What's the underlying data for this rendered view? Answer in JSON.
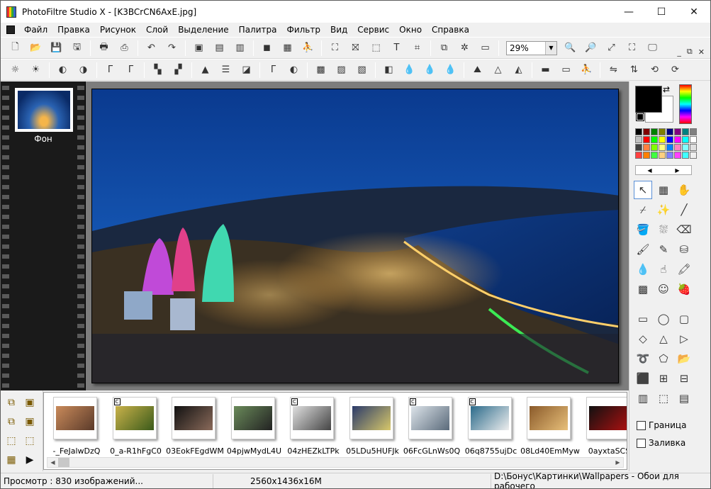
{
  "window": {
    "title": "PhotoFiltre Studio X - [K3BCrCN6AxE.jpg]",
    "controls": {
      "minimize": "—",
      "maximize": "☐",
      "close": "✕"
    }
  },
  "menu": {
    "items": [
      "Файл",
      "Правка",
      "Рисунок",
      "Слой",
      "Выделение",
      "Палитра",
      "Фильтр",
      "Вид",
      "Сервис",
      "Окно",
      "Справка"
    ],
    "mdi_controls": {
      "minimize": "_",
      "restore": "⧉",
      "close": "✕"
    }
  },
  "toolbar1": {
    "zoom_value": "29%"
  },
  "layers": {
    "items": [
      {
        "name": "Фон"
      }
    ]
  },
  "options": {
    "border_label": "Граница",
    "fill_label": "Заливка"
  },
  "browser": {
    "thumbnails": [
      {
        "label": "-_FeJalwDzQ",
        "copy": false,
        "colors": [
          "#c98a5a",
          "#5a3a2a"
        ]
      },
      {
        "label": "0_a-R1hFgC0",
        "copy": true,
        "copy_mark": "C",
        "colors": [
          "#c9b24a",
          "#3a5a1a"
        ]
      },
      {
        "label": "03EokFEgdWM",
        "copy": false,
        "colors": [
          "#111111",
          "#8a6a5a"
        ]
      },
      {
        "label": "04pjwMydL4U",
        "copy": false,
        "colors": [
          "#6a8a5a",
          "#222222"
        ]
      },
      {
        "label": "04zHEZkLTPk",
        "copy": true,
        "copy_mark": "C",
        "colors": [
          "#e0e0e0",
          "#444444"
        ]
      },
      {
        "label": "05LDu5HUFJk",
        "copy": false,
        "colors": [
          "#2a3a6a",
          "#d8c86a"
        ]
      },
      {
        "label": "06FcGLnWs0Q",
        "copy": true,
        "copy_mark": "C",
        "colors": [
          "#dde4ea",
          "#5a6a7a"
        ]
      },
      {
        "label": "06q8755ujDc",
        "copy": true,
        "copy_mark": "C",
        "colors": [
          "#2a6a8a",
          "#eeeeee"
        ]
      },
      {
        "label": "08Ld40EmMyw",
        "copy": false,
        "colors": [
          "#8a5a2a",
          "#e8c07a"
        ]
      },
      {
        "label": "0ayxtaSCS",
        "copy": false,
        "colors": [
          "#111111",
          "#aa1111"
        ]
      }
    ]
  },
  "status": {
    "preview": "Просмотр : 830 изображений...",
    "dimensions": "2560x1436x16M",
    "path": "D:\\Бонус\\Картинки\\Wallpapers - Обои для рабочего"
  },
  "colors": {
    "foreground": "#000000",
    "background": "#ffffff",
    "palette": [
      "#000000",
      "#800000",
      "#008000",
      "#808000",
      "#000080",
      "#800080",
      "#008080",
      "#808080",
      "#c0c0c0",
      "#ff0000",
      "#00ff00",
      "#ffff00",
      "#0000ff",
      "#ff00ff",
      "#00ffff",
      "#ffffff",
      "#404040",
      "#ff8040",
      "#80ff00",
      "#ffff80",
      "#0080ff",
      "#ff80c0",
      "#80ffff",
      "#e0e0e0",
      "#ff4040",
      "#ff8000",
      "#40ff40",
      "#ffd080",
      "#8080ff",
      "#ff40ff",
      "#40ffff",
      "#f0f0f0"
    ]
  }
}
